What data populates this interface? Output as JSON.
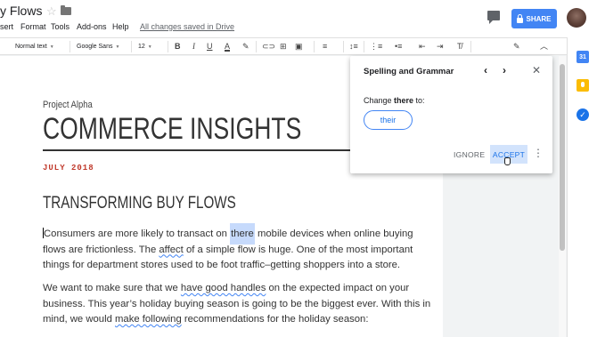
{
  "titlebar": {
    "doc_title": "y Flows",
    "menus": [
      "sert",
      "Format",
      "Tools",
      "Add-ons",
      "Help"
    ],
    "saved_status": "All changes saved in Drive",
    "share_label": "SHARE"
  },
  "toolbar": {
    "style": "Normal text",
    "font": "Google Sans",
    "size": "12"
  },
  "document": {
    "project": "Project Alpha",
    "title": "COMMERCE INSIGHTS",
    "date": "JULY 2018",
    "heading": "TRANSFORMING BUY FLOWS",
    "p1": {
      "l1a": "Consumers are more likely to transact on ",
      "l1b": "there",
      "l1c": " mobile devices when online buying",
      "l2a": "flows are frictionless. The ",
      "l2b": "affect",
      "l2c": " of a simple flow is huge. One of the most important",
      "l3": "things for department stores used to be foot traffic–getting shoppers into a store."
    },
    "p2": {
      "l1a": "We want to make sure that we ",
      "l1b": "have good handles",
      "l1c": " on the expected impact on your",
      "l2": "business. This year’s holiday buying season is going to be the biggest ever. With this in",
      "l3a": "mind, we would ",
      "l3b": "make following",
      "l3c": " recommendations for the holiday season:"
    }
  },
  "spelling": {
    "title": "Spelling and Grammar",
    "change_prefix": "Change ",
    "word": "there",
    "change_suffix": " to:",
    "suggestion": "their",
    "ignore": "IGNORE",
    "accept": "ACCEPT"
  },
  "side_panel": {
    "calendar_day": "31"
  },
  "colors": {
    "share": "#4285f4",
    "date_red": "#c0392b",
    "highlight": "#c6dafc",
    "accent": "#1a73e8"
  }
}
